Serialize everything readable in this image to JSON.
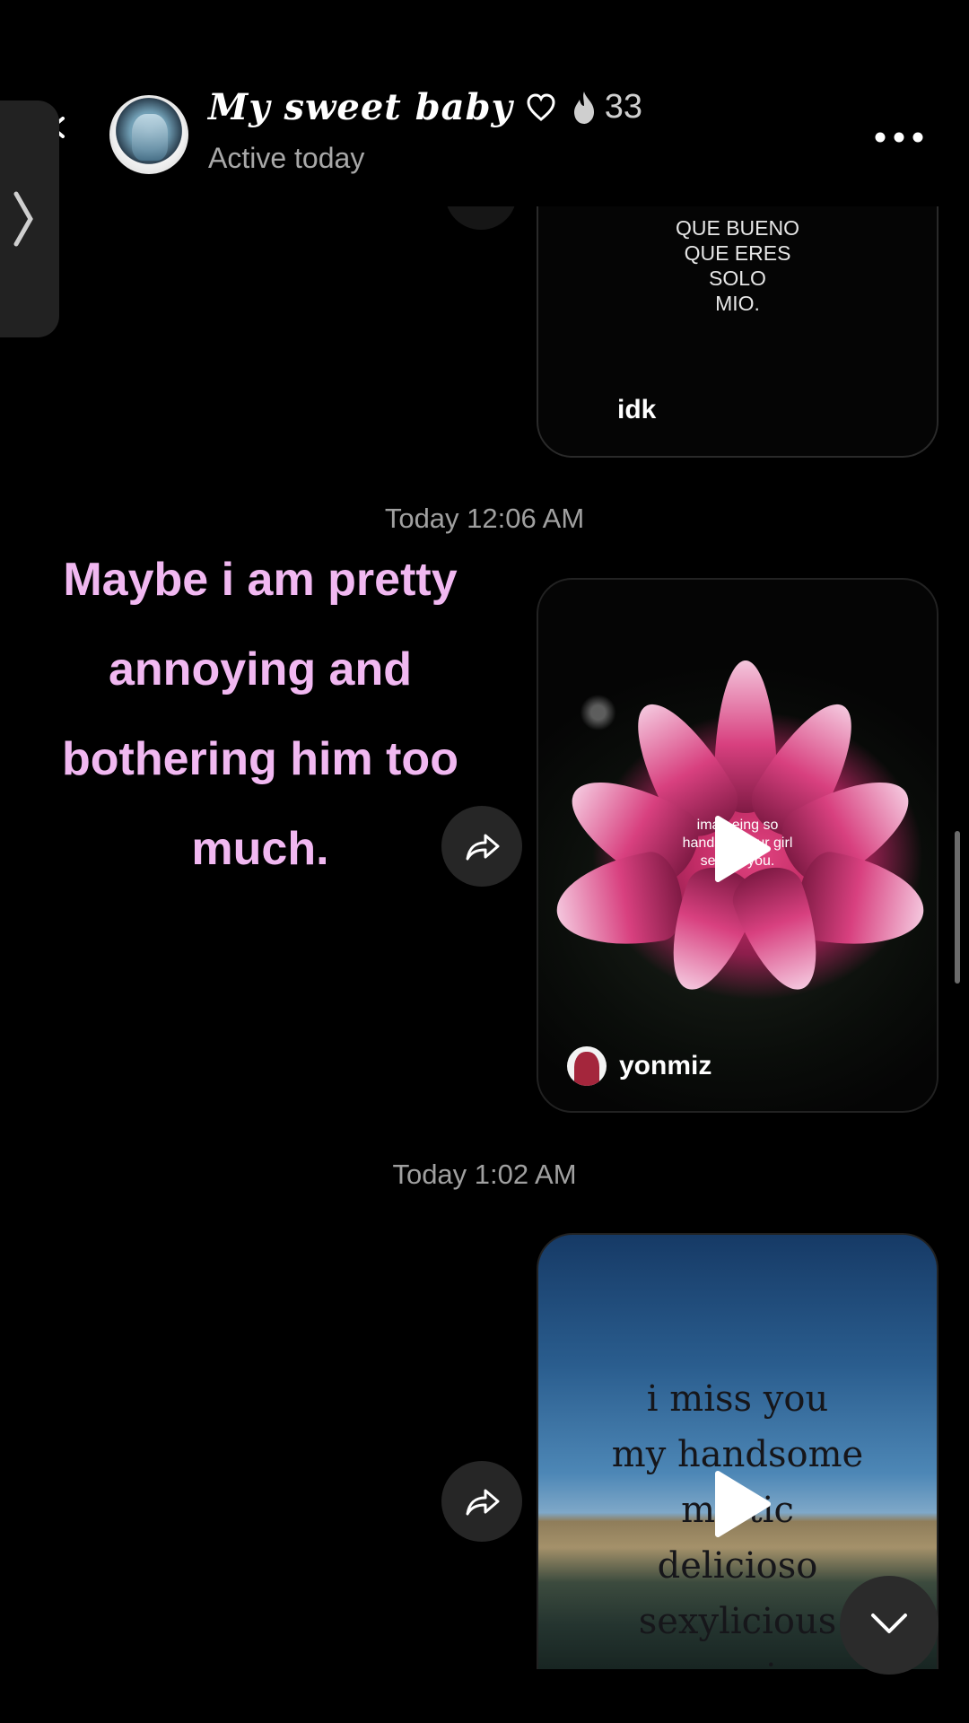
{
  "header": {
    "title": "My sweet baby",
    "streak_count": "33",
    "status": "Active today"
  },
  "messages": [
    {
      "type": "shared_video",
      "video_text": "QUE BUENO\nQUE ERES\nSOLO\nMIO.",
      "caption": "idk"
    },
    {
      "type": "timestamp",
      "text": "Today 12:06 AM"
    },
    {
      "type": "shared_video",
      "overlay_text": "imag  eing so\nhandson  your girl\nsent  to you.",
      "author": "yonmiz"
    },
    {
      "type": "timestamp",
      "text": "Today 1:02 AM"
    },
    {
      "type": "shared_video",
      "poem": "i miss you\nmy handsome\nma  tic\ndelicioso\nsexylicious\npapi"
    }
  ],
  "overlay": {
    "text": "Maybe i am pretty annoying and bothering him too much."
  },
  "colors": {
    "background": "#000000",
    "overlay_text": "#f1b8f1",
    "muted_text": "#a0a0a0"
  }
}
